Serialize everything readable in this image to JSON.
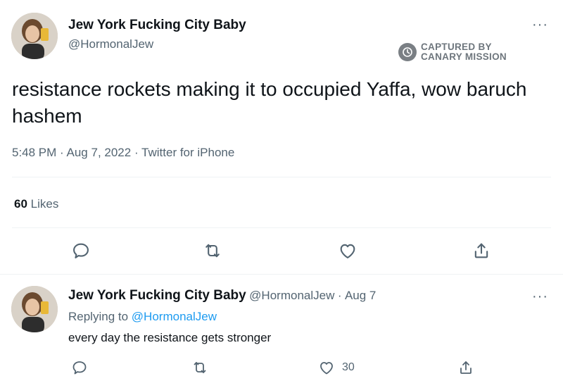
{
  "main_tweet": {
    "display_name": "Jew York Fucking City Baby",
    "handle": "@HormonalJew",
    "text": "resistance rockets making it to occupied Yaffa, wow baruch hashem",
    "time": "5:48 PM",
    "date": "Aug 7, 2022",
    "source": "Twitter for iPhone",
    "dot_separator": "·",
    "likes_count": "60",
    "likes_label": "Likes",
    "more_label": "···"
  },
  "watermark": {
    "line1": "CAPTURED BY",
    "line2": "CANARY MISSION"
  },
  "reply_tweet": {
    "display_name": "Jew York Fucking City Baby",
    "handle": "@HormonalJew",
    "dot_separator": "·",
    "date": "Aug 7",
    "replying_to_label": "Replying to",
    "replying_to_handle": "@HormonalJew",
    "text": "every day the resistance gets stronger",
    "likes_count": "30",
    "more_label": "···"
  },
  "icons": {
    "reply": "reply-icon",
    "retweet": "retweet-icon",
    "like": "heart-icon",
    "share": "share-icon"
  },
  "colors": {
    "text_primary": "#0f1419",
    "text_secondary": "#536471",
    "link": "#1d9bf0",
    "divider": "#eff3f4"
  }
}
